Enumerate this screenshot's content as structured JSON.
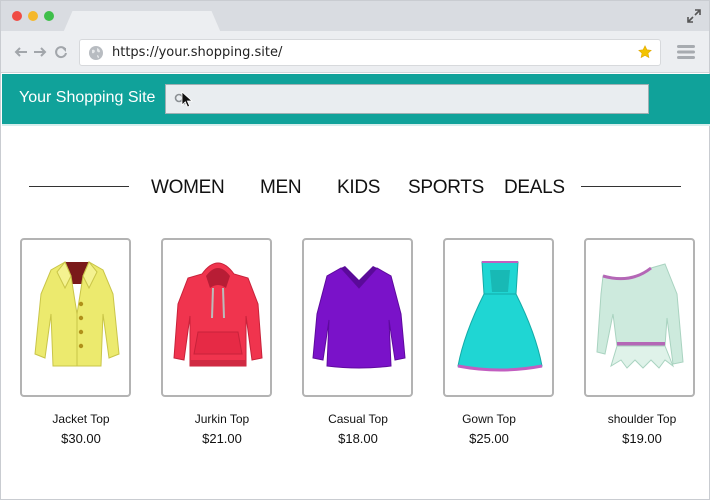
{
  "browser": {
    "url": "https://your.shopping.site/"
  },
  "site": {
    "title": "Your Shopping Site",
    "search_value": "",
    "accent": "#10a29a"
  },
  "categories": [
    "WOMEN",
    "MEN",
    "KIDS",
    "SPORTS",
    "DEALS"
  ],
  "products": [
    {
      "name": "Jacket Top",
      "price": "$30.00",
      "color": "#ecea6e"
    },
    {
      "name": "Jurkin Top",
      "price": "$21.00",
      "color": "#f0344e"
    },
    {
      "name": "Casual Top",
      "price": "$18.00",
      "color": "#7a12c9"
    },
    {
      "name": "Gown Top",
      "price": "$25.00",
      "color": "#1fd6d3"
    },
    {
      "name": "shoulder Top",
      "price": "$19.00",
      "color": "#cdeadd"
    }
  ]
}
